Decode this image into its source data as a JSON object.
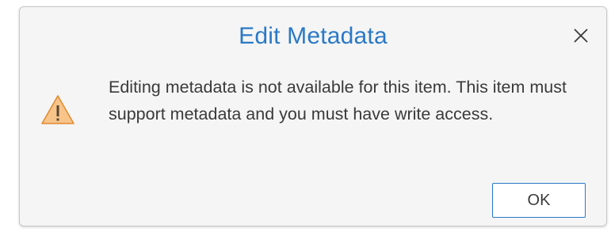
{
  "dialog": {
    "title": "Edit Metadata",
    "message": "Editing metadata is not available for this item. This item must support metadata and you must have write access.",
    "icon": "warning-icon",
    "close_icon": "close-icon",
    "ok_label": "OK"
  },
  "colors": {
    "title": "#2a79c7",
    "warning_fill": "#f7c48a",
    "warning_stroke": "#e08a2c",
    "button_border": "#2a79c7",
    "dialog_background": "#f5f5f5"
  }
}
